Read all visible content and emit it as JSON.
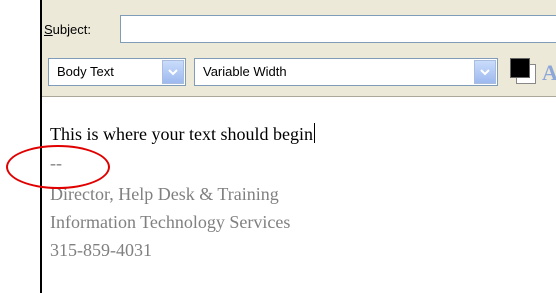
{
  "subject": {
    "label_prefix": "S",
    "label_rest": "ubject:",
    "value": ""
  },
  "toolbar": {
    "paragraph_style": "Body Text",
    "font_family": "Variable Width",
    "text_color": "#000000",
    "icons": [
      "chevron-down-icon",
      "text-color-icon",
      "font-color-icon"
    ]
  },
  "editor": {
    "body_text": "This is where your text should begin",
    "signature_separator": "--",
    "signature_lines": [
      "Director, Help Desk & Training",
      "Information Technology Services",
      "315-859-4031"
    ]
  },
  "annotation_color": "#e00000"
}
